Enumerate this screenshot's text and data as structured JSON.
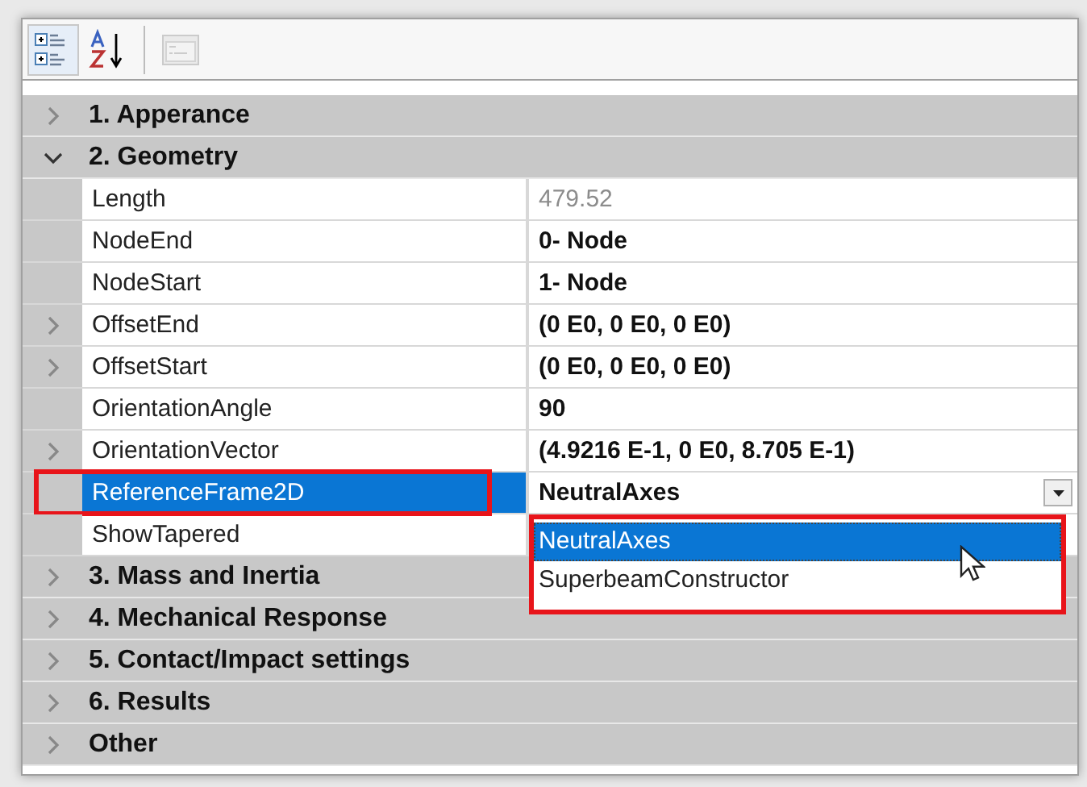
{
  "toolbar": [
    {
      "kind": "categorized",
      "selected": true,
      "disabled": false
    },
    {
      "kind": "alphabetical",
      "selected": false,
      "disabled": false
    },
    {
      "kind": "pages",
      "selected": false,
      "disabled": true
    }
  ],
  "categories": [
    {
      "label": "1. Apperance",
      "expanded": false
    },
    {
      "label": "2. Geometry",
      "expanded": true,
      "properties": [
        {
          "name": "Length",
          "value": "479.52",
          "readonly": true,
          "expandable": false,
          "selected": false,
          "highlighted": false
        },
        {
          "name": "NodeEnd",
          "value": "0- Node",
          "readonly": false,
          "expandable": false,
          "selected": false,
          "highlighted": false
        },
        {
          "name": "NodeStart",
          "value": "1- Node",
          "readonly": false,
          "expandable": false,
          "selected": false,
          "highlighted": false
        },
        {
          "name": "OffsetEnd",
          "value": "(0 E0, 0 E0, 0 E0)",
          "readonly": false,
          "expandable": true,
          "selected": false,
          "highlighted": false
        },
        {
          "name": "OffsetStart",
          "value": "(0 E0, 0 E0, 0 E0)",
          "readonly": false,
          "expandable": true,
          "selected": false,
          "highlighted": false
        },
        {
          "name": "OrientationAngle",
          "value": "90",
          "readonly": false,
          "expandable": false,
          "selected": false,
          "highlighted": false
        },
        {
          "name": "OrientationVector",
          "value": "(4.9216 E-1, 0 E0, 8.705 E-1)",
          "readonly": false,
          "expandable": true,
          "selected": false,
          "highlighted": false
        },
        {
          "name": "ReferenceFrame2D",
          "value": "NeutralAxes",
          "readonly": false,
          "expandable": false,
          "selected": true,
          "highlighted": true,
          "dropdown": {
            "highlighted": true,
            "options": [
              {
                "label": "NeutralAxes",
                "selected": true
              },
              {
                "label": "SuperbeamConstructor",
                "selected": false
              }
            ]
          }
        },
        {
          "name": "ShowTapered",
          "readonly": false,
          "expandable": false,
          "selected": false,
          "highlighted": false
        }
      ]
    },
    {
      "label": "3. Mass and Inertia",
      "expanded": false
    },
    {
      "label": "4. Mechanical Response",
      "expanded": false
    },
    {
      "label": "5. Contact/Impact settings",
      "expanded": false
    },
    {
      "label": "6. Results",
      "expanded": false
    },
    {
      "label": "Other",
      "expanded": false
    }
  ]
}
